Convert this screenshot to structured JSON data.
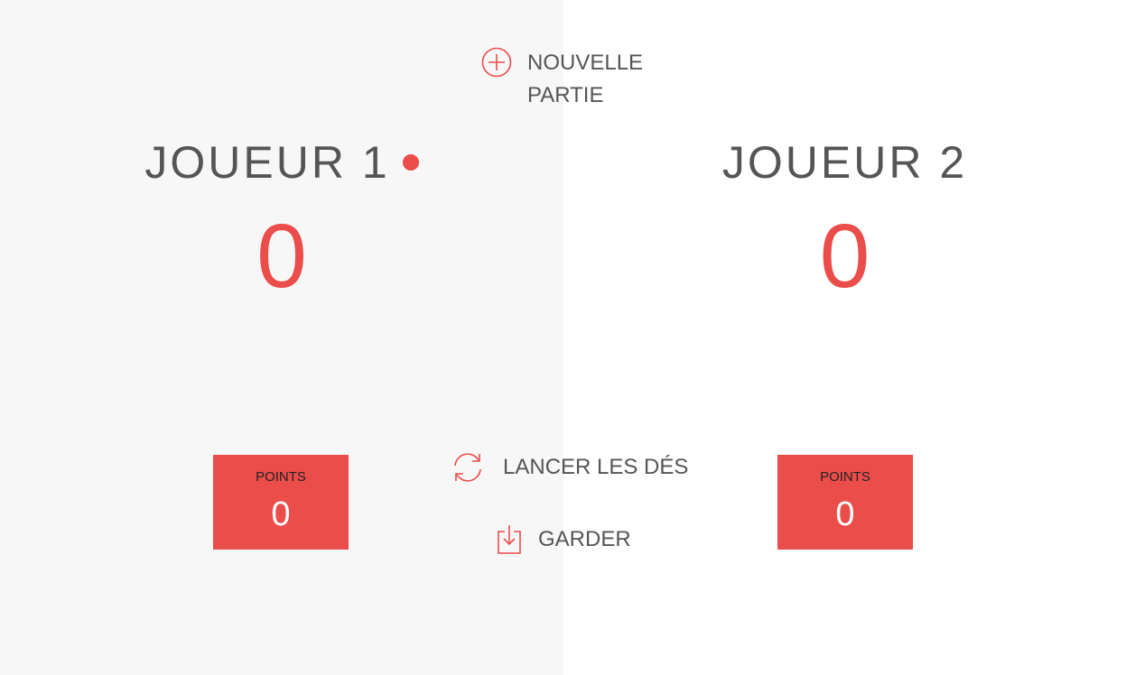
{
  "accent_color": "#eb4d4b",
  "new_game": {
    "label": "NOUVELLE PARTIE",
    "icon": "plus-circle-icon"
  },
  "players": [
    {
      "name": "JOUEUR 1",
      "score": "0",
      "current_label": "POINTS",
      "current_value": "0",
      "active": true
    },
    {
      "name": "JOUEUR 2",
      "score": "0",
      "current_label": "POINTS",
      "current_value": "0",
      "active": false
    }
  ],
  "roll_dice": {
    "label": "LANCER LES DÉS",
    "icon": "refresh-icon"
  },
  "hold": {
    "label": "GARDER",
    "icon": "download-icon"
  }
}
